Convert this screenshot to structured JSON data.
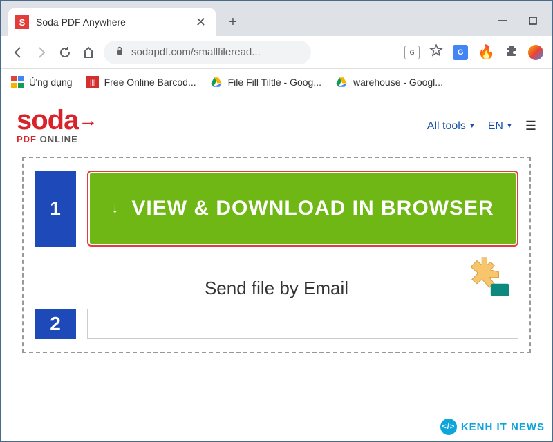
{
  "browser": {
    "tab": {
      "favicon": "S",
      "title": "Soda PDF Anywhere"
    },
    "url": "sodapdf.com/smallfileread...",
    "bookmarks": {
      "apps": "Ứng dụng",
      "barcode": "Free Online Barcod...",
      "drive1": "File Fill Tiltle - Goog...",
      "drive2": "warehouse - Googl..."
    }
  },
  "page": {
    "logo": {
      "main": "soda",
      "sub_pdf": "PDF",
      "sub_online": "ONLINE"
    },
    "menu": {
      "all_tools": "All tools",
      "lang": "EN"
    },
    "steps": {
      "one": "1",
      "download_btn": "VIEW & DOWNLOAD IN BROWSER",
      "email_title": "Send file by Email",
      "two": "2"
    }
  },
  "watermark": "KENH IT NEWS"
}
